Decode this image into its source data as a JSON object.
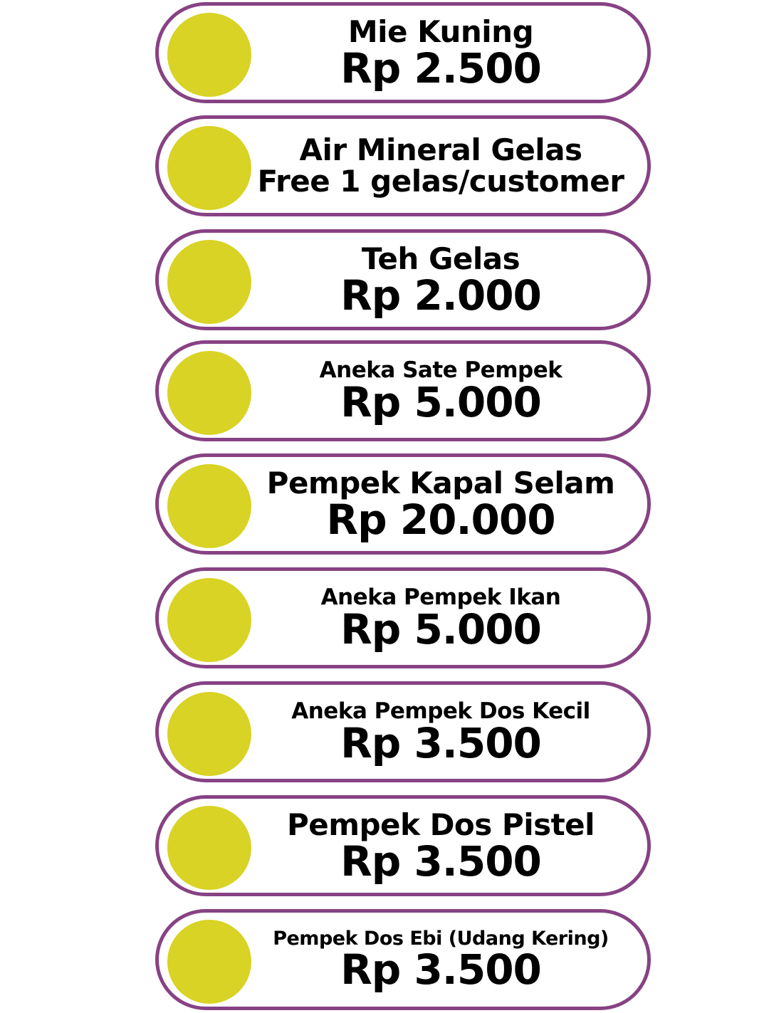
{
  "menu": {
    "items": [
      {
        "name": "Mie Kuning",
        "price": "Rp 2.500"
      },
      {
        "name": "Air Mineral Gelas",
        "price": "Free 1 gelas/customer"
      },
      {
        "name": "Teh Gelas",
        "price": "Rp 2.000"
      },
      {
        "name": "Aneka Sate Pempek",
        "price": "Rp 5.000"
      },
      {
        "name": "Pempek Kapal Selam",
        "price": "Rp 20.000"
      },
      {
        "name": "Aneka Pempek Ikan",
        "price": "Rp 5.000"
      },
      {
        "name": "Aneka Pempek Dos Kecil",
        "price": "Rp 3.500"
      },
      {
        "name": "Pempek Dos Pistel",
        "price": "Rp 3.500"
      },
      {
        "name": "Pempek Dos Ebi (Udang Kering)",
        "price": "Rp 3.500"
      }
    ]
  },
  "colors": {
    "border": "#874284",
    "dot": "#d8d325",
    "text": "#000000",
    "background": "#ffffff"
  }
}
